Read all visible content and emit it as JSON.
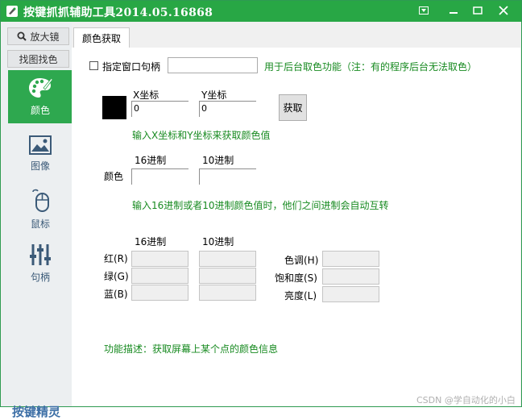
{
  "window": {
    "title": "按键抓抓辅助工具2014.05.16868"
  },
  "sidebar": {
    "magnifier_label": "放大镜",
    "find_color_label": "找图找色",
    "items": [
      {
        "label": "颜色",
        "icon": "palette-icon",
        "active": true
      },
      {
        "label": "图像",
        "icon": "image-icon",
        "active": false
      },
      {
        "label": "鼠标",
        "icon": "mouse-icon",
        "active": false
      },
      {
        "label": "句柄",
        "icon": "sliders-icon",
        "active": false
      }
    ],
    "brand": "按键精灵"
  },
  "tab": {
    "label": "颜色获取"
  },
  "window_handle": {
    "checkbox_label": "指定窗口句柄",
    "value": "",
    "hint": "用于后台取色功能（注：有的程序后台无法取色）"
  },
  "coords": {
    "x_label": "X坐标",
    "y_label": "Y坐标",
    "x_value": "0",
    "y_value": "0",
    "button": "获取",
    "hint": "输入X坐标和Y坐标来获取颜色值",
    "swatch_color": "#000000"
  },
  "color": {
    "hex_label": "16进制",
    "dec_label": "10进制",
    "row_label": "颜色",
    "hex_value": "",
    "dec_value": "",
    "hint": "输入16进制或者10进制颜色值时，他们之间进制会自动互转"
  },
  "rgb": {
    "hex_label": "16进制",
    "dec_label": "10进制",
    "r_label": "红(R)",
    "g_label": "绿(G)",
    "b_label": "蓝(B)",
    "h_label": "色调(H)",
    "s_label": "饱和度(S)",
    "l_label": "亮度(L)"
  },
  "description": "功能描述：获取屏幕上某个点的颜色信息",
  "watermark": "CSDN @学自动化的小白",
  "colors": {
    "accent": "#28a745",
    "hint_text": "#178a20",
    "nav_text": "#3b5a78"
  }
}
